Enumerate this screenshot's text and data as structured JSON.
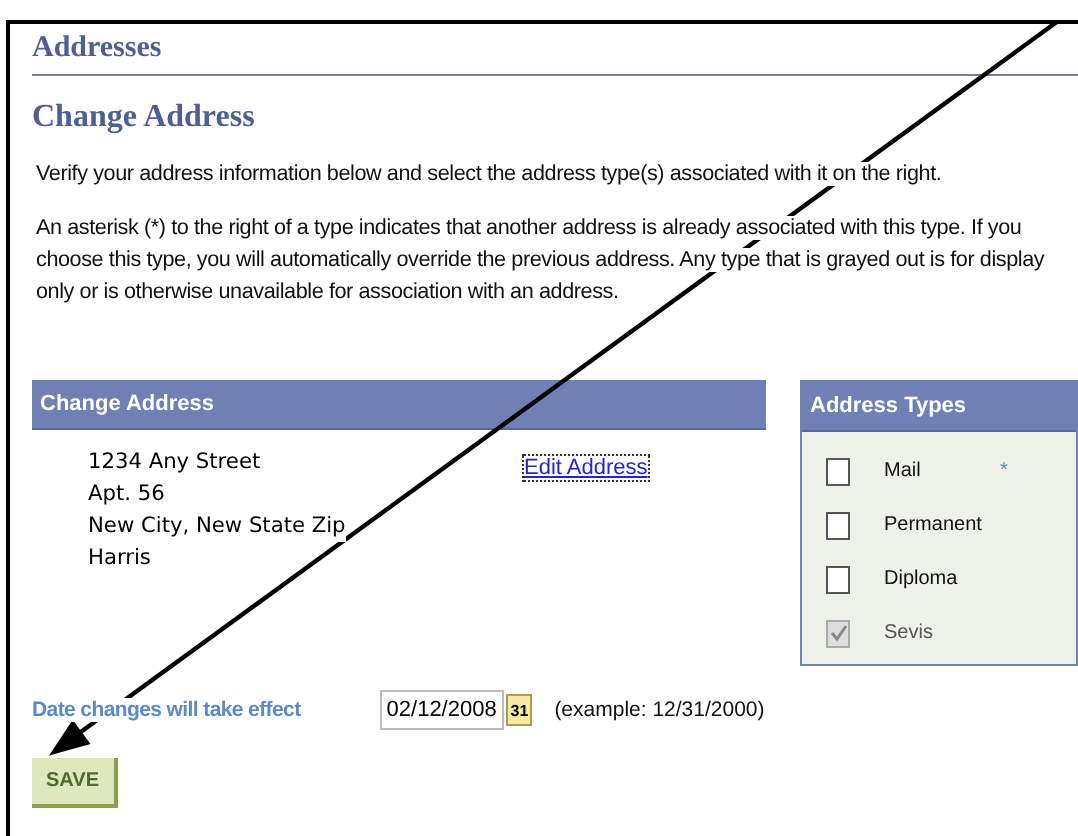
{
  "page": {
    "title": "Addresses",
    "heading": "Change Address"
  },
  "instructions": [
    "Verify your address information below and select the address type(s) associated with it on the right.",
    "An asterisk (*) to the right of a type indicates that another address is already associated with this type. If you choose this type, you will automatically override the previous address. Any type that is grayed out is for display only or is otherwise unavailable for association with an address."
  ],
  "address_panel": {
    "title": "Change Address",
    "lines": [
      "1234 Any Street",
      "Apt. 56",
      "New City, New State Zip",
      "Harris"
    ],
    "edit_link": "Edit Address"
  },
  "effective_date": {
    "label": "Date changes will take effect",
    "value": "02/12/2008",
    "calendar": "31",
    "example": "(example: 12/31/2000)"
  },
  "address_types": {
    "title": "Address Types",
    "items": [
      {
        "label": "Mail",
        "checked": false,
        "disabled": false,
        "note": "*"
      },
      {
        "label": "Permanent",
        "checked": false,
        "disabled": false
      },
      {
        "label": "Diploma",
        "checked": false,
        "disabled": false
      },
      {
        "label": "Sevis",
        "checked": true,
        "disabled": true
      }
    ]
  },
  "save_button": "SAVE"
}
